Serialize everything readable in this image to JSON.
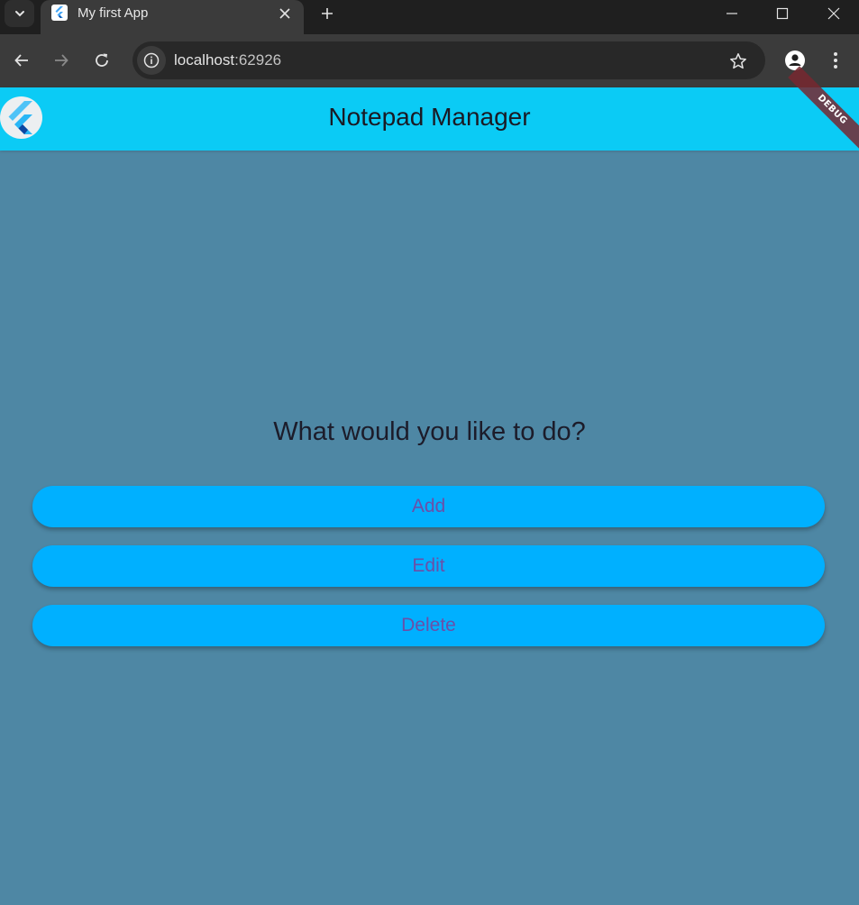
{
  "browser": {
    "tab": {
      "title": "My first App"
    },
    "address": {
      "host": "localhost",
      "port": ":62926"
    }
  },
  "app": {
    "title": "Notepad Manager",
    "debug_banner": "DEBUG",
    "prompt": "What would you like to do?",
    "actions": [
      {
        "label": "Add"
      },
      {
        "label": "Edit"
      },
      {
        "label": "Delete"
      }
    ],
    "colors": {
      "appbar": "#0bcbf5",
      "background": "#4e87a4",
      "button": "#00b0ff",
      "button_text": "#6b4fa8"
    }
  }
}
